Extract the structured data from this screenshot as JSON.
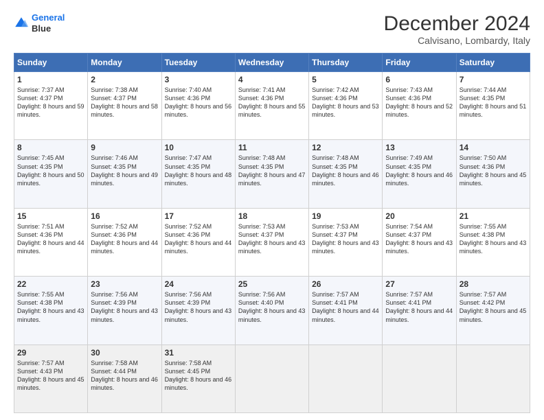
{
  "header": {
    "logo_line1": "General",
    "logo_line2": "Blue",
    "main_title": "December 2024",
    "sub_title": "Calvisano, Lombardy, Italy"
  },
  "days_of_week": [
    "Sunday",
    "Monday",
    "Tuesday",
    "Wednesday",
    "Thursday",
    "Friday",
    "Saturday"
  ],
  "weeks": [
    [
      {
        "day": "1",
        "sunrise": "Sunrise: 7:37 AM",
        "sunset": "Sunset: 4:37 PM",
        "daylight": "Daylight: 8 hours and 59 minutes."
      },
      {
        "day": "2",
        "sunrise": "Sunrise: 7:38 AM",
        "sunset": "Sunset: 4:37 PM",
        "daylight": "Daylight: 8 hours and 58 minutes."
      },
      {
        "day": "3",
        "sunrise": "Sunrise: 7:40 AM",
        "sunset": "Sunset: 4:36 PM",
        "daylight": "Daylight: 8 hours and 56 minutes."
      },
      {
        "day": "4",
        "sunrise": "Sunrise: 7:41 AM",
        "sunset": "Sunset: 4:36 PM",
        "daylight": "Daylight: 8 hours and 55 minutes."
      },
      {
        "day": "5",
        "sunrise": "Sunrise: 7:42 AM",
        "sunset": "Sunset: 4:36 PM",
        "daylight": "Daylight: 8 hours and 53 minutes."
      },
      {
        "day": "6",
        "sunrise": "Sunrise: 7:43 AM",
        "sunset": "Sunset: 4:36 PM",
        "daylight": "Daylight: 8 hours and 52 minutes."
      },
      {
        "day": "7",
        "sunrise": "Sunrise: 7:44 AM",
        "sunset": "Sunset: 4:35 PM",
        "daylight": "Daylight: 8 hours and 51 minutes."
      }
    ],
    [
      {
        "day": "8",
        "sunrise": "Sunrise: 7:45 AM",
        "sunset": "Sunset: 4:35 PM",
        "daylight": "Daylight: 8 hours and 50 minutes."
      },
      {
        "day": "9",
        "sunrise": "Sunrise: 7:46 AM",
        "sunset": "Sunset: 4:35 PM",
        "daylight": "Daylight: 8 hours and 49 minutes."
      },
      {
        "day": "10",
        "sunrise": "Sunrise: 7:47 AM",
        "sunset": "Sunset: 4:35 PM",
        "daylight": "Daylight: 8 hours and 48 minutes."
      },
      {
        "day": "11",
        "sunrise": "Sunrise: 7:48 AM",
        "sunset": "Sunset: 4:35 PM",
        "daylight": "Daylight: 8 hours and 47 minutes."
      },
      {
        "day": "12",
        "sunrise": "Sunrise: 7:48 AM",
        "sunset": "Sunset: 4:35 PM",
        "daylight": "Daylight: 8 hours and 46 minutes."
      },
      {
        "day": "13",
        "sunrise": "Sunrise: 7:49 AM",
        "sunset": "Sunset: 4:35 PM",
        "daylight": "Daylight: 8 hours and 46 minutes."
      },
      {
        "day": "14",
        "sunrise": "Sunrise: 7:50 AM",
        "sunset": "Sunset: 4:36 PM",
        "daylight": "Daylight: 8 hours and 45 minutes."
      }
    ],
    [
      {
        "day": "15",
        "sunrise": "Sunrise: 7:51 AM",
        "sunset": "Sunset: 4:36 PM",
        "daylight": "Daylight: 8 hours and 44 minutes."
      },
      {
        "day": "16",
        "sunrise": "Sunrise: 7:52 AM",
        "sunset": "Sunset: 4:36 PM",
        "daylight": "Daylight: 8 hours and 44 minutes."
      },
      {
        "day": "17",
        "sunrise": "Sunrise: 7:52 AM",
        "sunset": "Sunset: 4:36 PM",
        "daylight": "Daylight: 8 hours and 44 minutes."
      },
      {
        "day": "18",
        "sunrise": "Sunrise: 7:53 AM",
        "sunset": "Sunset: 4:37 PM",
        "daylight": "Daylight: 8 hours and 43 minutes."
      },
      {
        "day": "19",
        "sunrise": "Sunrise: 7:53 AM",
        "sunset": "Sunset: 4:37 PM",
        "daylight": "Daylight: 8 hours and 43 minutes."
      },
      {
        "day": "20",
        "sunrise": "Sunrise: 7:54 AM",
        "sunset": "Sunset: 4:37 PM",
        "daylight": "Daylight: 8 hours and 43 minutes."
      },
      {
        "day": "21",
        "sunrise": "Sunrise: 7:55 AM",
        "sunset": "Sunset: 4:38 PM",
        "daylight": "Daylight: 8 hours and 43 minutes."
      }
    ],
    [
      {
        "day": "22",
        "sunrise": "Sunrise: 7:55 AM",
        "sunset": "Sunset: 4:38 PM",
        "daylight": "Daylight: 8 hours and 43 minutes."
      },
      {
        "day": "23",
        "sunrise": "Sunrise: 7:56 AM",
        "sunset": "Sunset: 4:39 PM",
        "daylight": "Daylight: 8 hours and 43 minutes."
      },
      {
        "day": "24",
        "sunrise": "Sunrise: 7:56 AM",
        "sunset": "Sunset: 4:39 PM",
        "daylight": "Daylight: 8 hours and 43 minutes."
      },
      {
        "day": "25",
        "sunrise": "Sunrise: 7:56 AM",
        "sunset": "Sunset: 4:40 PM",
        "daylight": "Daylight: 8 hours and 43 minutes."
      },
      {
        "day": "26",
        "sunrise": "Sunrise: 7:57 AM",
        "sunset": "Sunset: 4:41 PM",
        "daylight": "Daylight: 8 hours and 44 minutes."
      },
      {
        "day": "27",
        "sunrise": "Sunrise: 7:57 AM",
        "sunset": "Sunset: 4:41 PM",
        "daylight": "Daylight: 8 hours and 44 minutes."
      },
      {
        "day": "28",
        "sunrise": "Sunrise: 7:57 AM",
        "sunset": "Sunset: 4:42 PM",
        "daylight": "Daylight: 8 hours and 45 minutes."
      }
    ],
    [
      {
        "day": "29",
        "sunrise": "Sunrise: 7:57 AM",
        "sunset": "Sunset: 4:43 PM",
        "daylight": "Daylight: 8 hours and 45 minutes."
      },
      {
        "day": "30",
        "sunrise": "Sunrise: 7:58 AM",
        "sunset": "Sunset: 4:44 PM",
        "daylight": "Daylight: 8 hours and 46 minutes."
      },
      {
        "day": "31",
        "sunrise": "Sunrise: 7:58 AM",
        "sunset": "Sunset: 4:45 PM",
        "daylight": "Daylight: 8 hours and 46 minutes."
      },
      null,
      null,
      null,
      null
    ]
  ]
}
